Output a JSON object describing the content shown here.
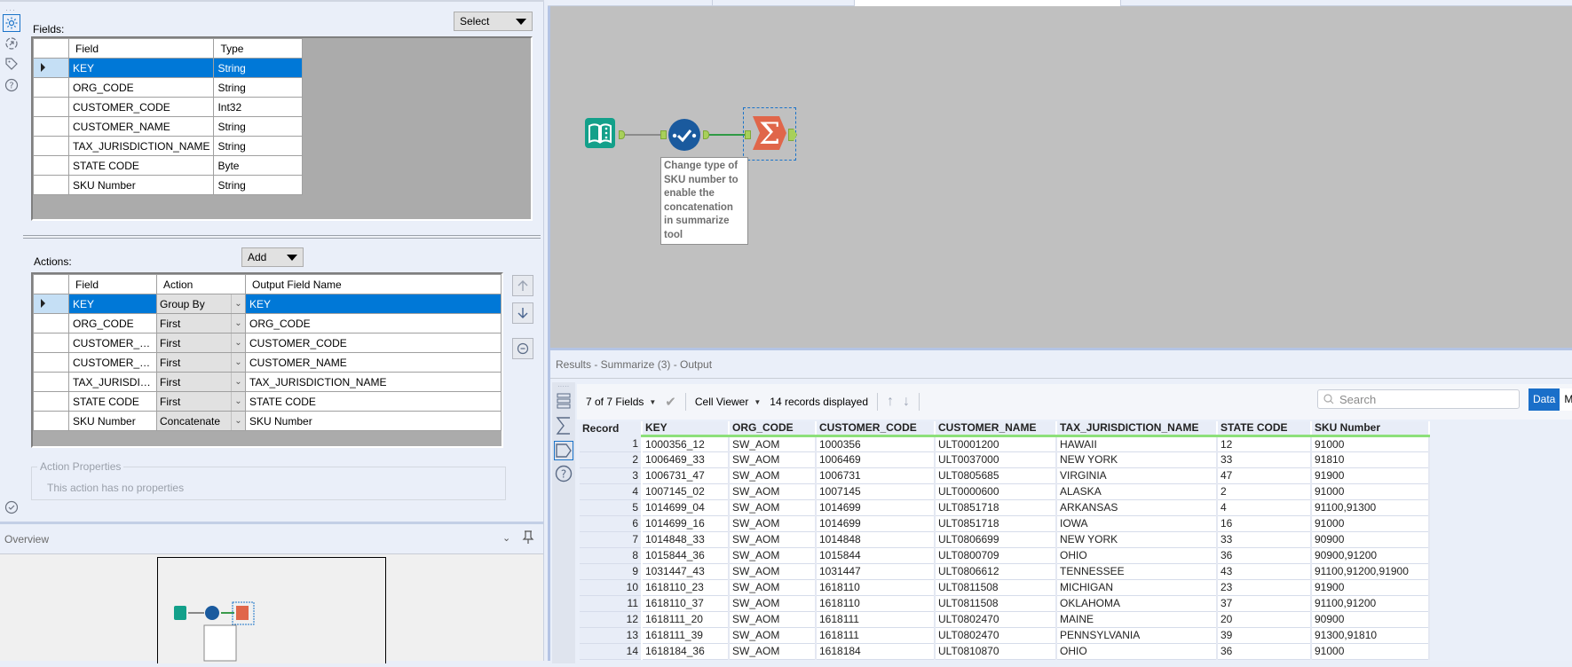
{
  "config": {
    "fields_label": "Fields:",
    "select_button": "Select",
    "fields_table": {
      "headers": [
        "Field",
        "Type"
      ],
      "rows": [
        {
          "field": "KEY",
          "type": "String",
          "selected": true
        },
        {
          "field": "ORG_CODE",
          "type": "String"
        },
        {
          "field": "CUSTOMER_CODE",
          "type": "Int32"
        },
        {
          "field": "CUSTOMER_NAME",
          "type": "String"
        },
        {
          "field": "TAX_JURISDICTION_NAME",
          "type": "String"
        },
        {
          "field": "STATE CODE",
          "type": "Byte"
        },
        {
          "field": "SKU Number",
          "type": "String"
        }
      ]
    },
    "actions_label": "Actions:",
    "add_button": "Add",
    "actions_table": {
      "headers": [
        "Field",
        "Action",
        "Output Field Name"
      ],
      "rows": [
        {
          "field": "KEY",
          "action": "Group By",
          "output": "KEY",
          "selected": true
        },
        {
          "field": "ORG_CODE",
          "action": "First",
          "output": "ORG_CODE"
        },
        {
          "field": "CUSTOMER_CO...",
          "action": "First",
          "output": "CUSTOMER_CODE"
        },
        {
          "field": "CUSTOMER_NA...",
          "action": "First",
          "output": "CUSTOMER_NAME"
        },
        {
          "field": "TAX_JURISDICTI...",
          "action": "First",
          "output": "TAX_JURISDICTION_NAME"
        },
        {
          "field": "STATE CODE",
          "action": "First",
          "output": "STATE CODE"
        },
        {
          "field": "SKU Number",
          "action": "Concatenate",
          "output": "SKU Number"
        }
      ]
    },
    "action_properties": {
      "legend": "Action Properties",
      "text": "This action has no properties"
    },
    "side_icons": [
      "gear-icon",
      "connection-progress-icon",
      "tag-icon",
      "help-icon"
    ],
    "bottom_icon": "check-circle-icon"
  },
  "overview": {
    "title": "Overview"
  },
  "canvas": {
    "annotation": "Change type of SKU number to enable the concatenation in summarize tool",
    "tools": [
      "input-data-tool",
      "select-tool",
      "summarize-tool"
    ]
  },
  "results": {
    "title": "Results - Summarize (3) - Output",
    "fields_selector": "7 of 7 Fields",
    "cell_viewer": "Cell Viewer",
    "records_displayed": "14 records displayed",
    "search_placeholder": "Search",
    "view_data": "Data",
    "view_metadata": "Metadata",
    "columns": [
      "Record",
      "KEY",
      "ORG_CODE",
      "CUSTOMER_CODE",
      "CUSTOMER_NAME",
      "TAX_JURISDICTION_NAME",
      "STATE CODE",
      "SKU Number"
    ],
    "rows": [
      [
        "1",
        "1000356_12",
        "SW_AOM",
        "1000356",
        "ULT0001200",
        "HAWAII",
        "12",
        "91000"
      ],
      [
        "2",
        "1006469_33",
        "SW_AOM",
        "1006469",
        "ULT0037000",
        "NEW YORK",
        "33",
        "91810"
      ],
      [
        "3",
        "1006731_47",
        "SW_AOM",
        "1006731",
        "ULT0805685",
        "VIRGINIA",
        "47",
        "91900"
      ],
      [
        "4",
        "1007145_02",
        "SW_AOM",
        "1007145",
        "ULT0000600",
        "ALASKA",
        "2",
        "91000"
      ],
      [
        "5",
        "1014699_04",
        "SW_AOM",
        "1014699",
        "ULT0851718",
        "ARKANSAS",
        "4",
        "91100,91300"
      ],
      [
        "6",
        "1014699_16",
        "SW_AOM",
        "1014699",
        "ULT0851718",
        "IOWA",
        "16",
        "91000"
      ],
      [
        "7",
        "1014848_33",
        "SW_AOM",
        "1014848",
        "ULT0806699",
        "NEW YORK",
        "33",
        "90900"
      ],
      [
        "8",
        "1015844_36",
        "SW_AOM",
        "1015844",
        "ULT0800709",
        "OHIO",
        "36",
        "90900,91200"
      ],
      [
        "9",
        "1031447_43",
        "SW_AOM",
        "1031447",
        "ULT0806612",
        "TENNESSEE",
        "43",
        "91100,91200,91900"
      ],
      [
        "10",
        "1618110_23",
        "SW_AOM",
        "1618110",
        "ULT0811508",
        "MICHIGAN",
        "23",
        "91900"
      ],
      [
        "11",
        "1618110_37",
        "SW_AOM",
        "1618110",
        "ULT0811508",
        "OKLAHOMA",
        "37",
        "91100,91200"
      ],
      [
        "12",
        "1618111_20",
        "SW_AOM",
        "1618111",
        "ULT0802470",
        "MAINE",
        "20",
        "90900"
      ],
      [
        "13",
        "1618111_39",
        "SW_AOM",
        "1618111",
        "ULT0802470",
        "PENNSYLVANIA",
        "39",
        "91300,91810"
      ],
      [
        "14",
        "1618184_36",
        "SW_AOM",
        "1618184",
        "ULT0810870",
        "OHIO",
        "36",
        "91000"
      ]
    ]
  }
}
